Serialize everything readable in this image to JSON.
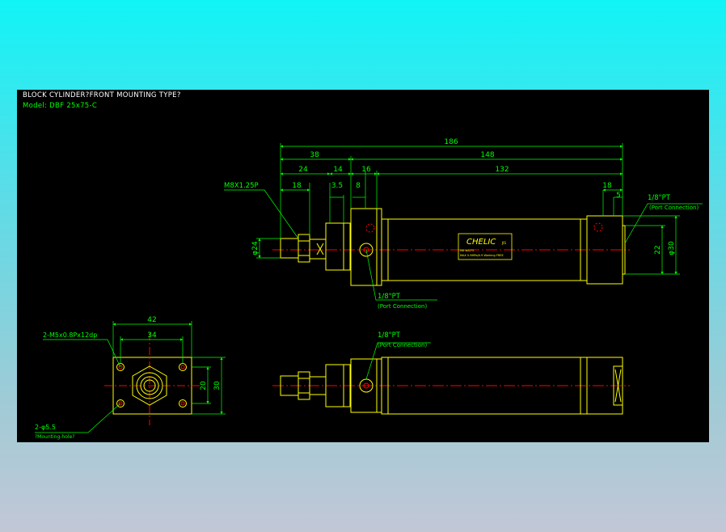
{
  "title": "BLOCK CYLINDER?FRONT MOUNTING TYPE?",
  "model": "Model:  DBF 25x75-C",
  "colors": {
    "background_top": "#10f4f6",
    "background_bottom": "#c2c7d6",
    "drawing_background": "#000000",
    "dimension": "#00ff00",
    "outline": "#ffff00",
    "centerline": "#ff0000",
    "title_text": "#ffffff"
  },
  "front_view": {
    "dims": {
      "overall": "186",
      "front_section": "38",
      "body_length": "148",
      "rod_to_flange": "24",
      "flange_gap": "14",
      "flange_width": "16",
      "tube_length": "132",
      "thread_length": "18",
      "shoulder": "3.5",
      "flange_half": "8",
      "rear_cap": "18",
      "port_offset": "5",
      "rod_dia": "φ24",
      "rear_height": "22",
      "body_dia": "φ30"
    },
    "rod_thread": "M8X1.25P",
    "rear_port": "1/8\"PT",
    "rear_port_note": "(Port Connection)",
    "front_port": "1/8\"PT",
    "front_port_note": "(Port Connection)",
    "brand": "CHELIC",
    "brand_suffix": "JIS",
    "label_line1": "MB ΦB/75",
    "label_line2": "MAX 0.9MPa/0.9 Working FREE"
  },
  "end_view": {
    "width_outer": "42",
    "width_inner": "34",
    "height_inner": "20",
    "height_outer": "30",
    "tapped_holes": "2-M5x0.8Px12dp",
    "mount_holes": "2-φ5.5",
    "mount_note": "?Mounting-hole?"
  },
  "side_view": {
    "port": "1/8\"PT",
    "port_note": "(Port Connection)"
  }
}
